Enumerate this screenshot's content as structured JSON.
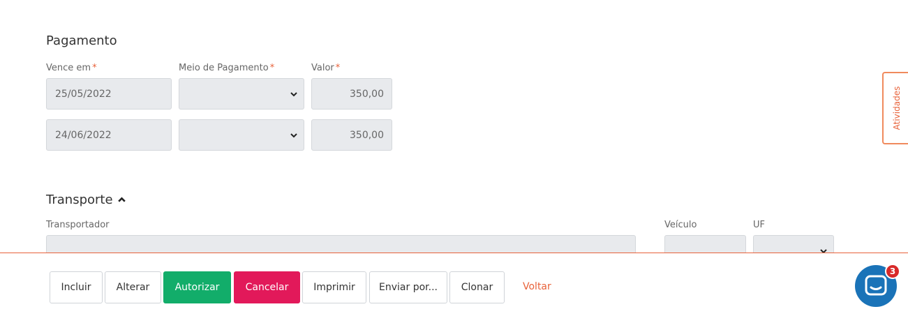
{
  "pagamento": {
    "title": "Pagamento",
    "labels": {
      "vence_em": "Vence em",
      "meio_pagamento": "Meio de Pagamento",
      "valor": "Valor",
      "required_mark": "*"
    },
    "rows": [
      {
        "vence_em": "25/05/2022",
        "meio_pagamento": "",
        "valor": "350,00"
      },
      {
        "vence_em": "24/06/2022",
        "meio_pagamento": "",
        "valor": "350,00"
      }
    ]
  },
  "transporte": {
    "title": "Transporte",
    "toggle_icon": "chevron-up-icon",
    "labels": {
      "transportador": "Transportador",
      "veiculo": "Veículo",
      "uf": "UF"
    },
    "transportador_value": ""
  },
  "side_tab": {
    "label": "Atividades"
  },
  "toolbar": {
    "incluir": "Incluir",
    "alterar": "Alterar",
    "autorizar": "Autorizar",
    "cancelar": "Cancelar",
    "imprimir": "Imprimir",
    "enviar_por": "Enviar por...",
    "clonar": "Clonar",
    "voltar": "Voltar"
  },
  "chat": {
    "icon": "chat-icon",
    "badge_count": "3"
  },
  "colors": {
    "accent": "#e8623a",
    "green": "#12ad6a",
    "red": "#e2195a",
    "chat_blue": "#1a73b8"
  }
}
